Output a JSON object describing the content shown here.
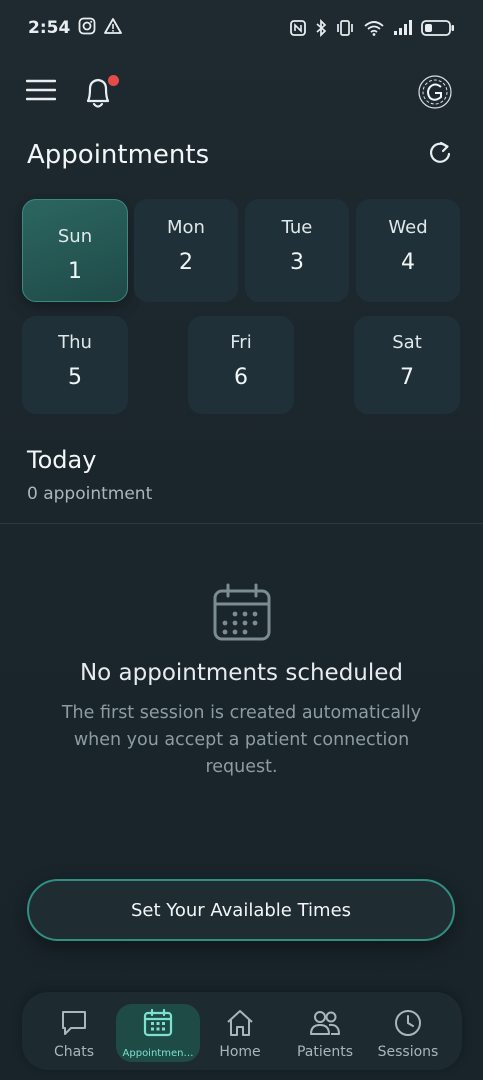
{
  "status_bar": {
    "time": "2:54"
  },
  "header": {
    "title": "Appointments"
  },
  "week": [
    {
      "day": "Sun",
      "date": "1",
      "selected": true
    },
    {
      "day": "Mon",
      "date": "2"
    },
    {
      "day": "Tue",
      "date": "3"
    },
    {
      "day": "Wed",
      "date": "4"
    },
    {
      "day": "Thu",
      "date": "5"
    },
    {
      "day": "Fri",
      "date": "6"
    },
    {
      "day": "Sat",
      "date": "7"
    }
  ],
  "today": {
    "title": "Today",
    "count_label": "0 appointment"
  },
  "empty_state": {
    "title": "No appointments scheduled",
    "body": "The first session is created automatically when you accept a patient connection request."
  },
  "cta": {
    "label": "Set Your Available Times"
  },
  "bottom_nav": {
    "items": [
      {
        "label": "Chats",
        "icon": "chat-icon"
      },
      {
        "label": "Appointmen…",
        "icon": "calendar-icon",
        "active": true
      },
      {
        "label": "Home",
        "icon": "home-icon"
      },
      {
        "label": "Patients",
        "icon": "patients-icon"
      },
      {
        "label": "Sessions",
        "icon": "clock-icon"
      }
    ]
  },
  "colors": {
    "accent": "#2f8f82",
    "selected_card": "#2c6660",
    "notification_dot": "#e54b4b"
  }
}
